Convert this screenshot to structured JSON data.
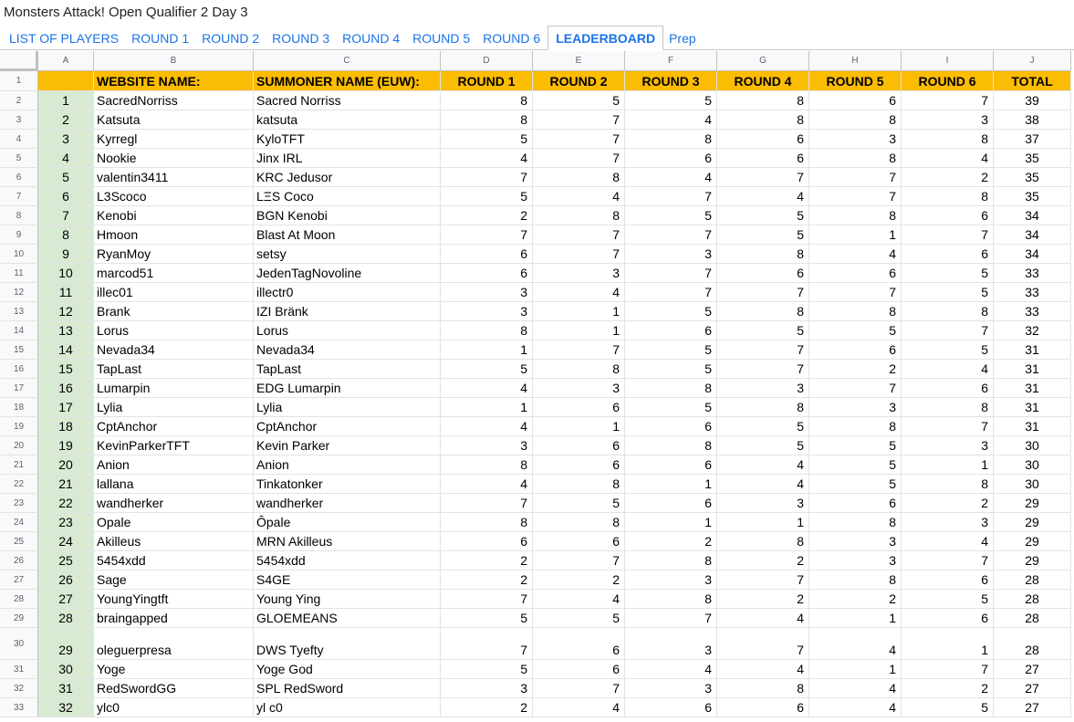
{
  "doc_title": "Monsters Attack! Open Qualifier 2 Day 3",
  "tabs": [
    {
      "label": "LIST OF PLAYERS",
      "active": false
    },
    {
      "label": "ROUND 1",
      "active": false
    },
    {
      "label": "ROUND 2",
      "active": false
    },
    {
      "label": "ROUND 3",
      "active": false
    },
    {
      "label": "ROUND 4",
      "active": false
    },
    {
      "label": "ROUND 5",
      "active": false
    },
    {
      "label": "ROUND 6",
      "active": false
    },
    {
      "label": "LEADERBOARD",
      "active": true
    },
    {
      "label": "Prep",
      "active": false
    }
  ],
  "column_letters": [
    "A",
    "B",
    "C",
    "D",
    "E",
    "F",
    "G",
    "H",
    "I",
    "J"
  ],
  "header_row": {
    "rownum": "1",
    "website": "WEBSITE NAME:",
    "summoner": "SUMMONER NAME (EUW):",
    "rounds": [
      "ROUND 1",
      "ROUND 2",
      "ROUND 3",
      "ROUND 4",
      "ROUND 5",
      "ROUND 6"
    ],
    "total": "TOTAL"
  },
  "colors": {
    "header_yellow": "#fbbc04",
    "rank_green": "#d9ead3",
    "link_blue": "#1a73e8"
  },
  "rows": [
    {
      "n": "2",
      "rank": "1",
      "website": "SacredNorriss",
      "summoner": "Sacred Norriss",
      "r": [
        "8",
        "5",
        "5",
        "8",
        "6",
        "7"
      ],
      "total": "39"
    },
    {
      "n": "3",
      "rank": "2",
      "website": "Katsuta",
      "summoner": "katsuta",
      "r": [
        "8",
        "7",
        "4",
        "8",
        "8",
        "3"
      ],
      "total": "38"
    },
    {
      "n": "4",
      "rank": "3",
      "website": "Kyrregl",
      "summoner": "KyloTFT",
      "r": [
        "5",
        "7",
        "8",
        "6",
        "3",
        "8"
      ],
      "total": "37"
    },
    {
      "n": "5",
      "rank": "4",
      "website": "Nookie",
      "summoner": "Jinx IRL",
      "r": [
        "4",
        "7",
        "6",
        "6",
        "8",
        "4"
      ],
      "total": "35"
    },
    {
      "n": "6",
      "rank": "5",
      "website": "valentin3411",
      "summoner": "KRC Jedusor",
      "r": [
        "7",
        "8",
        "4",
        "7",
        "7",
        "2"
      ],
      "total": "35"
    },
    {
      "n": "7",
      "rank": "6",
      "website": "L3Scoco",
      "summoner": "LΞS Coco",
      "r": [
        "5",
        "4",
        "7",
        "4",
        "7",
        "8"
      ],
      "total": "35"
    },
    {
      "n": "8",
      "rank": "7",
      "website": "Kenobi",
      "summoner": "BGN Kenobi",
      "r": [
        "2",
        "8",
        "5",
        "5",
        "8",
        "6"
      ],
      "total": "34"
    },
    {
      "n": "9",
      "rank": "8",
      "website": "Hmoon",
      "summoner": "Blast At Moon",
      "r": [
        "7",
        "7",
        "7",
        "5",
        "1",
        "7"
      ],
      "total": "34"
    },
    {
      "n": "10",
      "rank": "9",
      "website": "RyanMoy",
      "summoner": "setsy",
      "r": [
        "6",
        "7",
        "3",
        "8",
        "4",
        "6"
      ],
      "total": "34"
    },
    {
      "n": "11",
      "rank": "10",
      "website": "marcod51",
      "summoner": "JedenTagNovoline",
      "r": [
        "6",
        "3",
        "7",
        "6",
        "6",
        "5"
      ],
      "total": "33"
    },
    {
      "n": "12",
      "rank": "11",
      "website": "illec01",
      "summoner": "illectr0",
      "r": [
        "3",
        "4",
        "7",
        "7",
        "7",
        "5"
      ],
      "total": "33"
    },
    {
      "n": "13",
      "rank": "12",
      "website": "Brank",
      "summoner": "IZI Bränk",
      "r": [
        "3",
        "1",
        "5",
        "8",
        "8",
        "8"
      ],
      "total": "33"
    },
    {
      "n": "14",
      "rank": "13",
      "website": "Lorus",
      "summoner": "Lorus",
      "r": [
        "8",
        "1",
        "6",
        "5",
        "5",
        "7"
      ],
      "total": "32"
    },
    {
      "n": "15",
      "rank": "14",
      "website": "Nevada34",
      "summoner": "Nevada34",
      "r": [
        "1",
        "7",
        "5",
        "7",
        "6",
        "5"
      ],
      "total": "31"
    },
    {
      "n": "16",
      "rank": "15",
      "website": "TapLast",
      "summoner": "TapLast",
      "r": [
        "5",
        "8",
        "5",
        "7",
        "2",
        "4"
      ],
      "total": "31"
    },
    {
      "n": "17",
      "rank": "16",
      "website": "Lumarpin",
      "summoner": "EDG Lumarpin",
      "r": [
        "4",
        "3",
        "8",
        "3",
        "7",
        "6"
      ],
      "total": "31"
    },
    {
      "n": "18",
      "rank": "17",
      "website": "Lylia",
      "summoner": "Lylia",
      "r": [
        "1",
        "6",
        "5",
        "8",
        "3",
        "8"
      ],
      "total": "31"
    },
    {
      "n": "19",
      "rank": "18",
      "website": "CptAnchor",
      "summoner": "CptAnchor",
      "r": [
        "4",
        "1",
        "6",
        "5",
        "8",
        "7"
      ],
      "total": "31"
    },
    {
      "n": "20",
      "rank": "19",
      "website": "KevinParkerTFT",
      "summoner": "Kevin Parker",
      "r": [
        "3",
        "6",
        "8",
        "5",
        "5",
        "3"
      ],
      "total": "30"
    },
    {
      "n": "21",
      "rank": "20",
      "website": "Anion",
      "summoner": "Anion",
      "r": [
        "8",
        "6",
        "6",
        "4",
        "5",
        "1"
      ],
      "total": "30"
    },
    {
      "n": "22",
      "rank": "21",
      "website": "lallana",
      "summoner": "Tinkatonker",
      "r": [
        "4",
        "8",
        "1",
        "4",
        "5",
        "8"
      ],
      "total": "30"
    },
    {
      "n": "23",
      "rank": "22",
      "website": "wandherker",
      "summoner": "wandherker",
      "r": [
        "7",
        "5",
        "6",
        "3",
        "6",
        "2"
      ],
      "total": "29"
    },
    {
      "n": "24",
      "rank": "23",
      "website": "Opale",
      "summoner": "Ôpale",
      "r": [
        "8",
        "8",
        "1",
        "1",
        "8",
        "3"
      ],
      "total": "29"
    },
    {
      "n": "25",
      "rank": "24",
      "website": "Akilleus",
      "summoner": "MRN Akilleus",
      "r": [
        "6",
        "6",
        "2",
        "8",
        "3",
        "4"
      ],
      "total": "29"
    },
    {
      "n": "26",
      "rank": "25",
      "website": "5454xdd",
      "summoner": "5454xdd",
      "r": [
        "2",
        "7",
        "8",
        "2",
        "3",
        "7"
      ],
      "total": "29"
    },
    {
      "n": "27",
      "rank": "26",
      "website": "Sage",
      "summoner": "S4GE",
      "r": [
        "2",
        "2",
        "3",
        "7",
        "8",
        "6"
      ],
      "total": "28"
    },
    {
      "n": "28",
      "rank": "27",
      "website": "YoungYingtft",
      "summoner": "Young Ying",
      "r": [
        "7",
        "4",
        "8",
        "2",
        "2",
        "5"
      ],
      "total": "28"
    },
    {
      "n": "29",
      "rank": "28",
      "website": "braingapped",
      "summoner": "GLOEMEANS",
      "r": [
        "5",
        "5",
        "7",
        "4",
        "1",
        "6"
      ],
      "total": "28"
    },
    {
      "n": "30",
      "rank": "29",
      "website": "oleguerpresa",
      "summoner": "DWS Tyefty",
      "r": [
        "7",
        "6",
        "3",
        "7",
        "4",
        "1"
      ],
      "total": "28",
      "tall": true
    },
    {
      "n": "31",
      "rank": "30",
      "website": "Yoge",
      "summoner": "Yoge God",
      "r": [
        "5",
        "6",
        "4",
        "4",
        "1",
        "7"
      ],
      "total": "27"
    },
    {
      "n": "32",
      "rank": "31",
      "website": "RedSwordGG",
      "summoner": "SPL RedSword",
      "r": [
        "3",
        "7",
        "3",
        "8",
        "4",
        "2"
      ],
      "total": "27"
    },
    {
      "n": "33",
      "rank": "32",
      "website": "ylc0",
      "summoner": "yl c0",
      "r": [
        "2",
        "4",
        "6",
        "6",
        "4",
        "5"
      ],
      "total": "27"
    }
  ]
}
